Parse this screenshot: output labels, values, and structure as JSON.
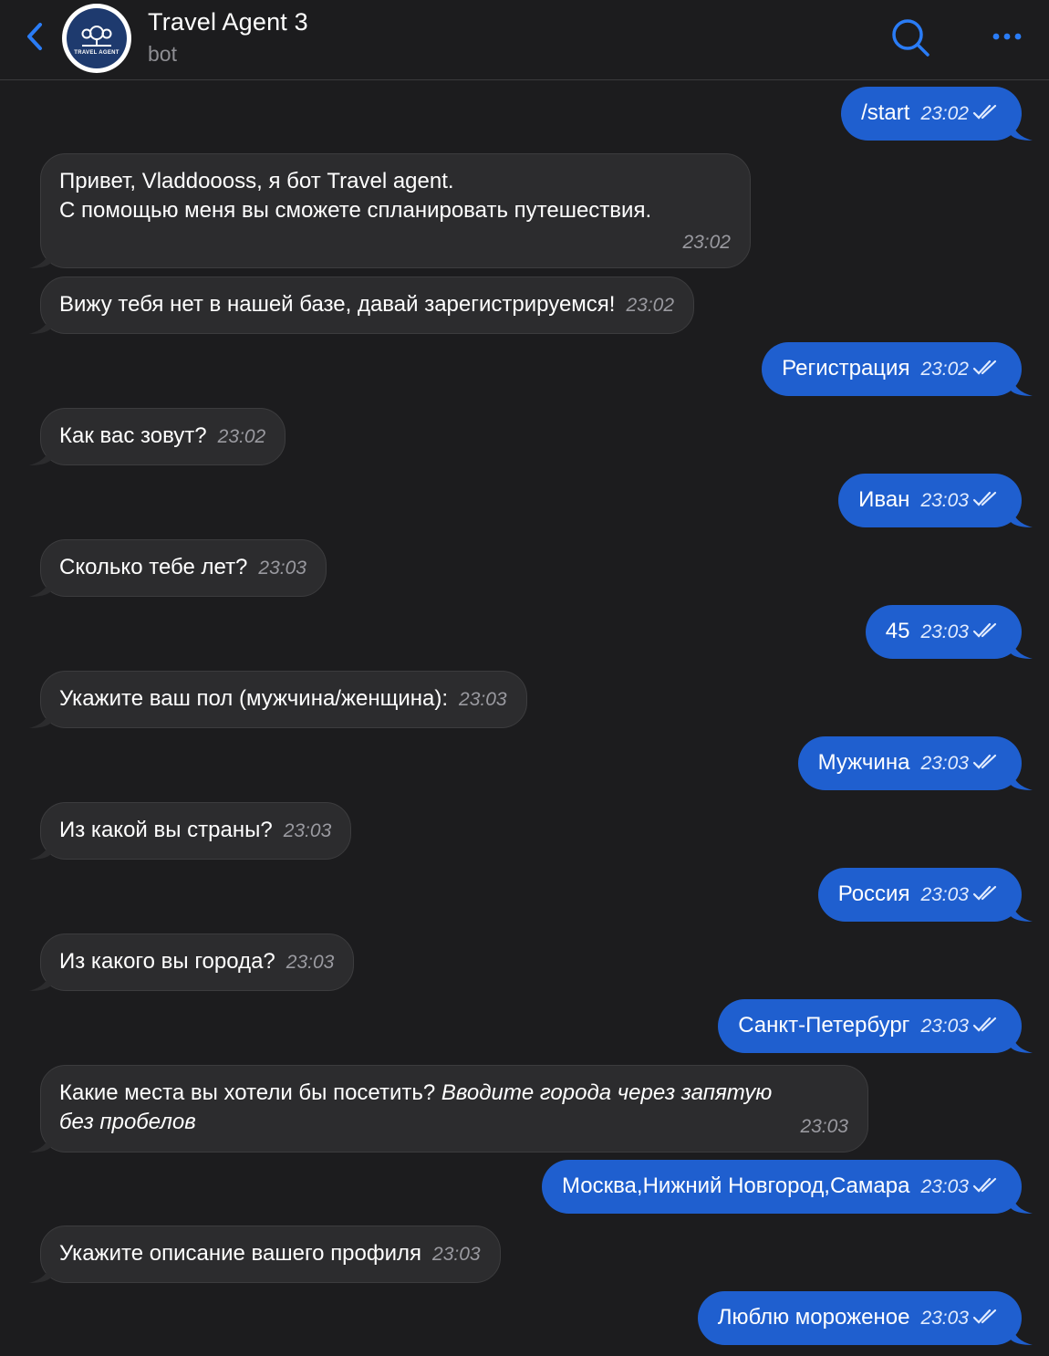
{
  "header": {
    "title": "Travel Agent 3",
    "subtitle": "bot",
    "avatar_text": "TRAVEL AGENT"
  },
  "colors": {
    "background": "#1c1c1e",
    "incoming_bubble": "#2c2c2e",
    "outgoing_bubble": "#1f5fcf",
    "accent": "#2a7cf6"
  },
  "messages": [
    {
      "dir": "out",
      "text": "/start",
      "time": "23:02"
    },
    {
      "dir": "in",
      "line1": "Привет, Vladdoooss, я бот Travel agent.",
      "line2": "С помощью меня вы сможете спланировать путешествия.",
      "time": "23:02"
    },
    {
      "dir": "in",
      "text": "Вижу тебя нет в нашей базе, давай зарегистрируемся!",
      "time": "23:02"
    },
    {
      "dir": "out",
      "text": "Регистрация",
      "time": "23:02"
    },
    {
      "dir": "in",
      "text": "Как вас зовут?",
      "time": "23:02"
    },
    {
      "dir": "out",
      "text": "Иван",
      "time": "23:03"
    },
    {
      "dir": "in",
      "text": "Сколько тебе лет?",
      "time": "23:03"
    },
    {
      "dir": "out",
      "text": "45",
      "time": "23:03"
    },
    {
      "dir": "in",
      "text": "Укажите ваш пол (мужчина/женщина):",
      "time": "23:03"
    },
    {
      "dir": "out",
      "text": "Мужчина",
      "time": "23:03"
    },
    {
      "dir": "in",
      "text": "Из какой вы страны?",
      "time": "23:03"
    },
    {
      "dir": "out",
      "text": "Россия",
      "time": "23:03"
    },
    {
      "dir": "in",
      "text": "Из какого вы города?",
      "time": "23:03"
    },
    {
      "dir": "out",
      "text": "Санкт-Петербург",
      "time": "23:03"
    },
    {
      "dir": "in",
      "text": "Какие места вы хотели бы посетить?",
      "hint_line1": "Вводите города через запятую",
      "hint_line2": "без пробелов",
      "time": "23:03"
    },
    {
      "dir": "out",
      "text": "Москва,Нижний Новгород,Самара",
      "time": "23:03"
    },
    {
      "dir": "in",
      "text": "Укажите описание вашего профиля",
      "time": "23:03"
    },
    {
      "dir": "out",
      "text": "Люблю мороженое",
      "time": "23:03"
    }
  ]
}
